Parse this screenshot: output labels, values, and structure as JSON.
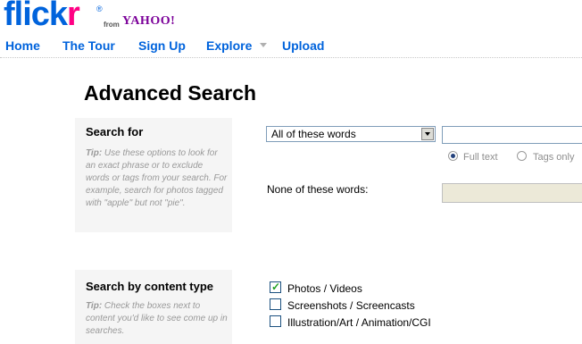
{
  "header": {
    "logo": {
      "flickr": "flickr",
      "from": "from",
      "yahoo": "YAHOO!"
    },
    "nav": [
      {
        "label": "Home"
      },
      {
        "label": "The Tour"
      },
      {
        "label": "Sign Up"
      },
      {
        "label": "Explore"
      },
      {
        "label": "Upload"
      }
    ]
  },
  "page": {
    "title": "Advanced Search"
  },
  "search_for": {
    "title": "Search for",
    "tip_label": "Tip:",
    "tip_text": " Use these options to look for an exact phrase or to exclude words or tags from your search. For example, search for photos tagged with \"apple\" but not \"pie\".",
    "match_select": {
      "selected": "All of these words"
    },
    "query_input": {
      "value": ""
    },
    "scope": {
      "options": [
        {
          "label": "Full text",
          "selected": true
        },
        {
          "label": "Tags only",
          "selected": false
        }
      ]
    },
    "none_of_these": {
      "label": "None of these words:",
      "value": ""
    }
  },
  "content_type": {
    "title": "Search by content type",
    "tip_label": "Tip:",
    "tip_text": " Check the boxes next to content you'd like to see come up in searches.",
    "options": [
      {
        "label": "Photos / Videos",
        "checked": true
      },
      {
        "label": "Screenshots / Screencasts",
        "checked": false
      },
      {
        "label": "Illustration/Art / Animation/CGI",
        "checked": false
      }
    ]
  }
}
